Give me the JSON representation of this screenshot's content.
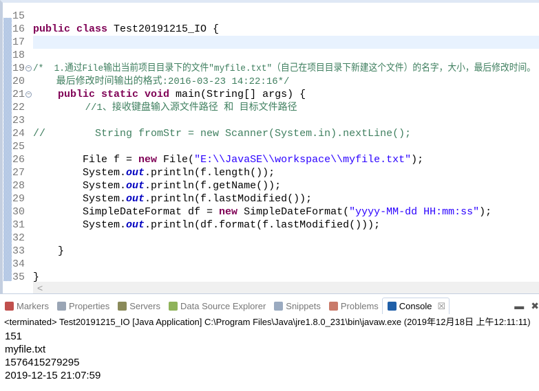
{
  "editor": {
    "lines": [
      {
        "n": "15",
        "tokens": []
      },
      {
        "n": "16",
        "tokens": [
          {
            "t": "public class ",
            "c": "kw"
          },
          {
            "t": "Test20191215_IO {",
            "c": "tx"
          }
        ]
      },
      {
        "n": "17",
        "tokens": [],
        "highlight": true
      },
      {
        "n": "18",
        "tokens": []
      },
      {
        "n": "19",
        "fold": true,
        "tokens": [
          {
            "t": "/*  1.通过File输出当前项目目录下的文件\"myfile.txt\"（自己在项目目录下新建这个文件）的名字，大小，最后修改时间。",
            "c": "cm"
          }
        ]
      },
      {
        "n": "20",
        "tokens": [
          {
            "t": "    最后修改时间输出的格式:2016-03-23 14:22:16*/",
            "c": "cm"
          }
        ]
      },
      {
        "n": "21",
        "fold": true,
        "tokens": [
          {
            "t": "    public static void ",
            "c": "kw"
          },
          {
            "t": "main(String[] args) {",
            "c": "tx"
          }
        ]
      },
      {
        "n": "22",
        "tokens": [
          {
            "t": "         //1、接收键盘输入源文件路径 和 目标文件路径",
            "c": "cm"
          }
        ]
      },
      {
        "n": "23",
        "tokens": []
      },
      {
        "n": "24",
        "tokens": [
          {
            "t": "//        String fromStr = new Scanner(System.in).nextLine();",
            "c": "cm"
          }
        ]
      },
      {
        "n": "25",
        "tokens": []
      },
      {
        "n": "26",
        "tokens": [
          {
            "t": "        File f = ",
            "c": "tx"
          },
          {
            "t": "new ",
            "c": "kw"
          },
          {
            "t": "File(",
            "c": "tx"
          },
          {
            "t": "\"E:\\\\JavaSE\\\\workspace\\\\myfile.txt\"",
            "c": "st"
          },
          {
            "t": ");",
            "c": "tx"
          }
        ]
      },
      {
        "n": "27",
        "tokens": [
          {
            "t": "        System.",
            "c": "tx"
          },
          {
            "t": "out",
            "c": "fi"
          },
          {
            "t": ".println(f.length());",
            "c": "tx"
          }
        ]
      },
      {
        "n": "28",
        "tokens": [
          {
            "t": "        System.",
            "c": "tx"
          },
          {
            "t": "out",
            "c": "fi"
          },
          {
            "t": ".println(f.getName());",
            "c": "tx"
          }
        ]
      },
      {
        "n": "29",
        "tokens": [
          {
            "t": "        System.",
            "c": "tx"
          },
          {
            "t": "out",
            "c": "fi"
          },
          {
            "t": ".println(f.lastModified());",
            "c": "tx"
          }
        ]
      },
      {
        "n": "30",
        "tokens": [
          {
            "t": "        SimpleDateFormat df = ",
            "c": "tx"
          },
          {
            "t": "new ",
            "c": "kw"
          },
          {
            "t": "SimpleDateFormat(",
            "c": "tx"
          },
          {
            "t": "\"yyyy-MM-dd HH:mm:ss\"",
            "c": "st"
          },
          {
            "t": ");",
            "c": "tx"
          }
        ]
      },
      {
        "n": "31",
        "tokens": [
          {
            "t": "        System.",
            "c": "tx"
          },
          {
            "t": "out",
            "c": "fi"
          },
          {
            "t": ".println(df.format(f.lastModified()));",
            "c": "tx"
          }
        ]
      },
      {
        "n": "32",
        "tokens": []
      },
      {
        "n": "33",
        "tokens": [
          {
            "t": "    }",
            "c": "tx"
          }
        ]
      },
      {
        "n": "34",
        "tokens": []
      },
      {
        "n": "35",
        "tokens": [
          {
            "t": "}",
            "c": "tx"
          }
        ]
      }
    ],
    "scroll_left": "<"
  },
  "panel": {
    "tabs": [
      {
        "label": "Markers",
        "icon": "markers-icon",
        "color": "#c0504d"
      },
      {
        "label": "Properties",
        "icon": "properties-icon",
        "color": "#9aa5b5"
      },
      {
        "label": "Servers",
        "icon": "servers-icon",
        "color": "#8a8a5a"
      },
      {
        "label": "Data Source Explorer",
        "icon": "data-source-icon",
        "color": "#8fb35a"
      },
      {
        "label": "Snippets",
        "icon": "snippets-icon",
        "color": "#9aaac0"
      },
      {
        "label": "Problems",
        "icon": "problems-icon",
        "color": "#c97a6a"
      },
      {
        "label": "Console",
        "icon": "console-icon",
        "color": "#1f5fa8",
        "active": true,
        "close": "☒"
      }
    ],
    "minimize": "▬",
    "close": "✖",
    "terminated": "<terminated> Test20191215_IO [Java Application] C:\\Program Files\\Java\\jre1.8.0_231\\bin\\javaw.exe (2019年12月18日 上午12:11:11)",
    "output": [
      "151",
      "myfile.txt",
      "1576415279295",
      "2019-12-15 21:07:59"
    ]
  }
}
